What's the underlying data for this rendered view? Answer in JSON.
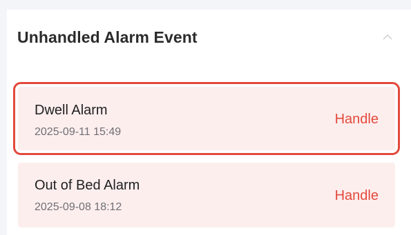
{
  "panel": {
    "title": "Unhandled Alarm Event",
    "toggle_icon": "chevron-up-icon"
  },
  "alarms": [
    {
      "name": "Dwell Alarm",
      "time": "2025-09-11 15:49",
      "action": "Handle",
      "selected": true
    },
    {
      "name": "Out of Bed Alarm",
      "time": "2025-09-08 18:12",
      "action": "Handle",
      "selected": false
    }
  ],
  "colors": {
    "accent": "#e2493b",
    "item_background": "#fdeeee",
    "page_background": "#f4f5f8"
  }
}
